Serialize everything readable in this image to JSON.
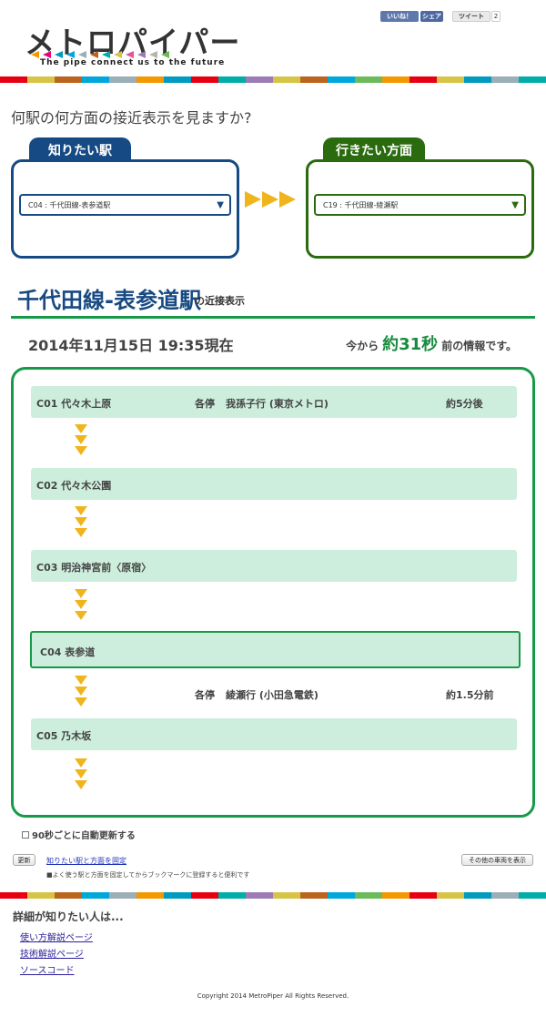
{
  "header": {
    "logo_title": "メトロパイパー",
    "logo_subtitle": "The pipe connect us to the future",
    "logo_colors": [
      "#f39800",
      "#e4007f",
      "#009bbf",
      "#00a7db",
      "#9caeb7",
      "#bb641d",
      "#00ada9",
      "#d7c447",
      "#e85298",
      "#9b7cb6",
      "#b5b5ac",
      "#6cbb5a"
    ],
    "fb_like": "いいね！",
    "fb_share": "シェア",
    "tweet": "ツイート",
    "tweet_count": "2"
  },
  "stripe_colors": [
    "#e60012",
    "#d7c447",
    "#bb641d",
    "#00a7db",
    "#9caeb7",
    "#f39800",
    "#009bbf",
    "#e60012",
    "#00ada9",
    "#9b7cb6",
    "#d7c447",
    "#bb641d",
    "#00a7db",
    "#6cbb5a",
    "#f39800",
    "#e60012",
    "#d7c447",
    "#009bbf",
    "#9caeb7",
    "#00ada9"
  ],
  "question": "何駅の何方面の接近表示を見ますか?",
  "from": {
    "tab": "知りたい駅",
    "value": "C04 : 千代田線-表参道駅",
    "color": "#164a84"
  },
  "to": {
    "tab": "行きたい方面",
    "value": "C19 : 千代田線-綾瀬駅",
    "color": "#2b6b10"
  },
  "station": {
    "title": "千代田線-表参道駅",
    "suffix": "の近接表示"
  },
  "status": {
    "datetime": "2014年11月15日 19:35現在",
    "prefix": "今から",
    "seconds": "約31秒",
    "suffix": "前の情報です。"
  },
  "stations": [
    {
      "name": "C01 代々木上原"
    },
    {
      "name": "C02 代々木公園"
    },
    {
      "name": "C03 明治神宮前〈原宿〉"
    },
    {
      "name": "C04 表参道"
    },
    {
      "name": "C05 乃木坂"
    }
  ],
  "trains": [
    {
      "type": "各停",
      "dest": "我孫子行 (東京メトロ)",
      "eta": "約5分後"
    },
    {
      "type": "各停",
      "dest": "綾瀬行 (小田急電鉄)",
      "eta": "約1.5分前"
    }
  ],
  "controls": {
    "auto_refresh": "90秒ごとに自動更新する",
    "refresh_button": "更新",
    "fix_link": "知りたい駅と方面を固定",
    "fix_note": "■よく使う駅と方面を固定してからブックマークに登録すると便利です",
    "others_button": "その他の車両を表示"
  },
  "footer": {
    "title": "詳細が知りたい人は...",
    "links": [
      "使い方解説ページ",
      "技術解説ページ",
      "ソースコード"
    ],
    "copyright": "Copyright 2014 MetroPiper All Rights Reserved."
  }
}
